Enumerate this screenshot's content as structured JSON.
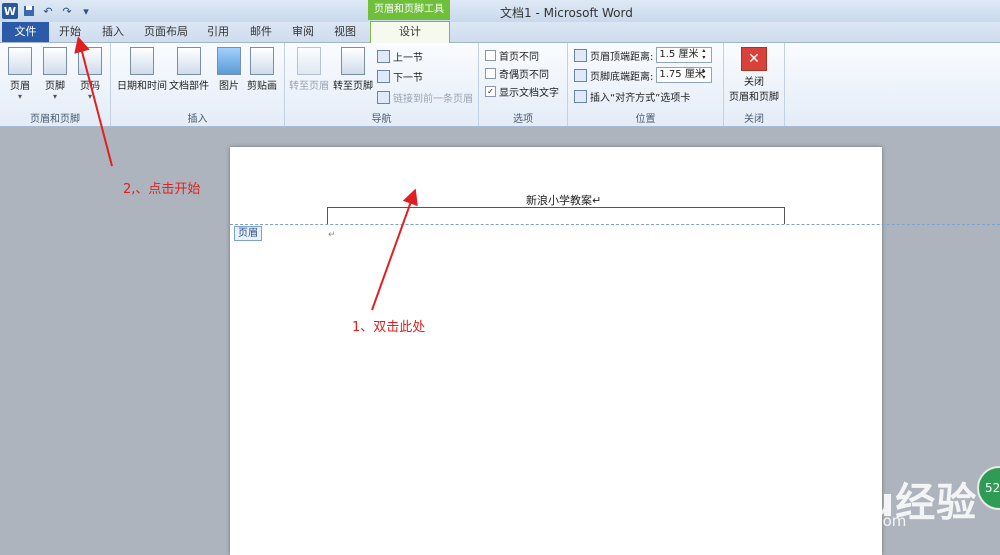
{
  "titlebar": {
    "app_icon": "W",
    "undo_icon": "↶",
    "redo_icon": "↷",
    "customize_icon": "▾",
    "title": "文档1 - Microsoft Word",
    "contextual_group": "页眉和页脚工具"
  },
  "tabs": [
    "文件",
    "开始",
    "插入",
    "页面布局",
    "引用",
    "邮件",
    "审阅",
    "视图"
  ],
  "design_tab": "设计",
  "ribbon": {
    "header_footer_group": {
      "label": "页眉和页脚",
      "header": "页眉",
      "footer": "页脚",
      "page_number": "页码"
    },
    "insert_group": {
      "label": "插入",
      "date_time": "日期和时间",
      "doc_parts": "文档部件",
      "picture": "图片",
      "clip_art": "剪贴画"
    },
    "nav_group": {
      "label": "导航",
      "goto_header": "转至页眉",
      "goto_footer": "转至页脚",
      "prev_section": "上一节",
      "next_section": "下一节",
      "link_prev": "链接到前一条页眉"
    },
    "options_group": {
      "label": "选项",
      "first_page": "首页不同",
      "odd_even": "奇偶页不同",
      "show_text": "显示文档文字",
      "show_text_checked": true
    },
    "position_group": {
      "label": "位置",
      "header_top": "页眉顶端距离:",
      "header_top_value": "1.5 厘米",
      "footer_bottom": "页脚底端距离:",
      "footer_bottom_value": "1.75 厘米",
      "insert_align": "插入“对齐方式”选项卡"
    },
    "close_group": {
      "label": "关闭",
      "close_btn_line1": "关闭",
      "close_btn_line2": "页眉和页脚"
    }
  },
  "document": {
    "header_text": "新浪小学教案↵",
    "header_tag": "页眉",
    "para_mark": "↵"
  },
  "annotations": {
    "one": "1、双击此处",
    "two": "2,、点击开始"
  },
  "watermark": {
    "brand": "Baidu经验",
    "url": "jingyan.baidu.com",
    "badge": "52"
  },
  "colors": {
    "annotation": "#e02020",
    "file_tab": "#2b5aa8",
    "contextual": "#6fbf3b"
  }
}
